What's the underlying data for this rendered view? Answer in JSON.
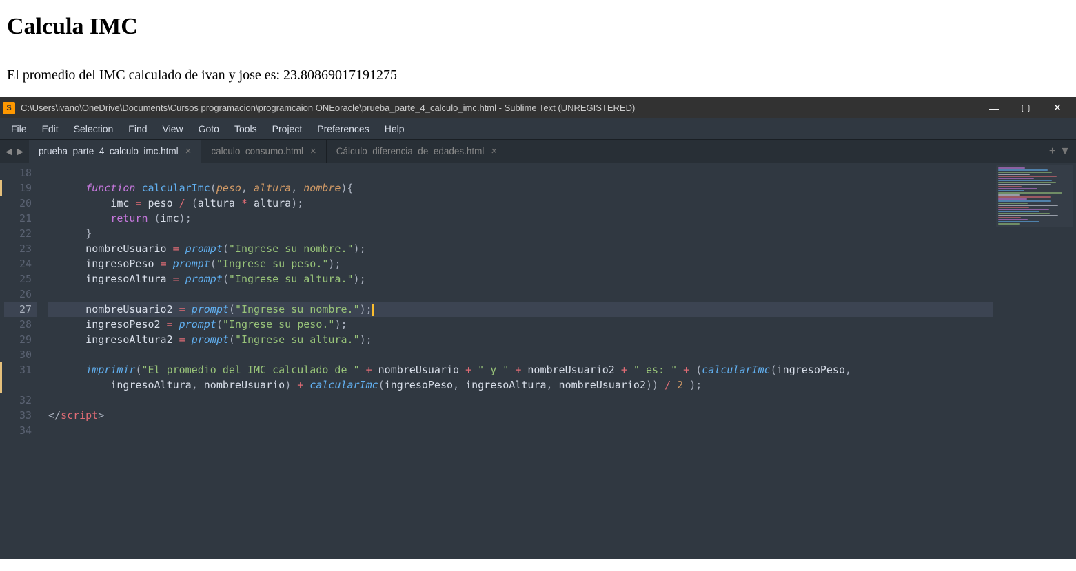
{
  "browser": {
    "heading": "Calcula IMC",
    "result_text": "El promedio del IMC calculado de ivan y jose es: 23.80869017191275"
  },
  "titlebar": {
    "icon_glyph": "S",
    "path": "C:\\Users\\ivano\\OneDrive\\Documents\\Cursos programacion\\programcaion ONEoracle\\prueba_parte_4_calculo_imc.html - Sublime Text (UNREGISTERED)"
  },
  "win": {
    "min": "—",
    "max": "▢",
    "close": "✕"
  },
  "menu": [
    "File",
    "Edit",
    "Selection",
    "Find",
    "View",
    "Goto",
    "Tools",
    "Project",
    "Preferences",
    "Help"
  ],
  "tabs": {
    "back": "◀",
    "fwd": "▶",
    "plus": "+",
    "drop": "▼",
    "items": [
      {
        "label": "prueba_parte_4_calculo_imc.html",
        "active": true
      },
      {
        "label": "calculo_consumo.html",
        "active": false
      },
      {
        "label": "Cálculo_diferencia_de_edades.html",
        "active": false
      }
    ]
  },
  "editor": {
    "first_line": 18,
    "current_line": 27,
    "marked_lines": [
      19,
      31
    ],
    "lines": [
      {
        "n": 18,
        "tokens": []
      },
      {
        "n": 19,
        "tokens": [
          {
            "t": "      ",
            "c": ""
          },
          {
            "t": "function",
            "c": "kw-it"
          },
          {
            "t": " ",
            "c": ""
          },
          {
            "t": "calcularImc",
            "c": "fn"
          },
          {
            "t": "(",
            "c": "pun"
          },
          {
            "t": "peso",
            "c": "param"
          },
          {
            "t": ",",
            "c": "pun"
          },
          {
            "t": " ",
            "c": ""
          },
          {
            "t": "altura",
            "c": "param"
          },
          {
            "t": ",",
            "c": "pun"
          },
          {
            "t": " ",
            "c": ""
          },
          {
            "t": "nombre",
            "c": "param"
          },
          {
            "t": ")",
            "c": "pun"
          },
          {
            "t": "{",
            "c": "pun"
          }
        ]
      },
      {
        "n": 20,
        "tokens": [
          {
            "t": "          imc ",
            "c": "var"
          },
          {
            "t": "=",
            "c": "op"
          },
          {
            "t": " peso ",
            "c": "var"
          },
          {
            "t": "/",
            "c": "op"
          },
          {
            "t": " ",
            "c": ""
          },
          {
            "t": "(",
            "c": "pun"
          },
          {
            "t": "altura ",
            "c": "var"
          },
          {
            "t": "*",
            "c": "op"
          },
          {
            "t": " altura",
            "c": "var"
          },
          {
            "t": ")",
            "c": "pun"
          },
          {
            "t": ";",
            "c": "pun"
          }
        ]
      },
      {
        "n": 21,
        "tokens": [
          {
            "t": "          ",
            "c": ""
          },
          {
            "t": "return",
            "c": "kw"
          },
          {
            "t": " ",
            "c": ""
          },
          {
            "t": "(",
            "c": "pun"
          },
          {
            "t": "imc",
            "c": "var"
          },
          {
            "t": ")",
            "c": "pun"
          },
          {
            "t": ";",
            "c": "pun"
          }
        ]
      },
      {
        "n": 22,
        "tokens": [
          {
            "t": "      ",
            "c": ""
          },
          {
            "t": "}",
            "c": "pun"
          }
        ]
      },
      {
        "n": 23,
        "tokens": [
          {
            "t": "      nombreUsuario ",
            "c": "var"
          },
          {
            "t": "=",
            "c": "op"
          },
          {
            "t": " ",
            "c": ""
          },
          {
            "t": "prompt",
            "c": "fn-it"
          },
          {
            "t": "(",
            "c": "pun"
          },
          {
            "t": "\"Ingrese su nombre.\"",
            "c": "str"
          },
          {
            "t": ")",
            "c": "pun"
          },
          {
            "t": ";",
            "c": "pun"
          }
        ]
      },
      {
        "n": 24,
        "tokens": [
          {
            "t": "      ingresoPeso ",
            "c": "var"
          },
          {
            "t": "=",
            "c": "op"
          },
          {
            "t": " ",
            "c": ""
          },
          {
            "t": "prompt",
            "c": "fn-it"
          },
          {
            "t": "(",
            "c": "pun"
          },
          {
            "t": "\"Ingrese su peso.\"",
            "c": "str"
          },
          {
            "t": ")",
            "c": "pun"
          },
          {
            "t": ";",
            "c": "pun"
          }
        ]
      },
      {
        "n": 25,
        "tokens": [
          {
            "t": "      ingresoAltura ",
            "c": "var"
          },
          {
            "t": "=",
            "c": "op"
          },
          {
            "t": " ",
            "c": ""
          },
          {
            "t": "prompt",
            "c": "fn-it"
          },
          {
            "t": "(",
            "c": "pun"
          },
          {
            "t": "\"Ingrese su altura.\"",
            "c": "str"
          },
          {
            "t": ")",
            "c": "pun"
          },
          {
            "t": ";",
            "c": "pun"
          }
        ]
      },
      {
        "n": 26,
        "tokens": []
      },
      {
        "n": 27,
        "tokens": [
          {
            "t": "      nombreUsuario2 ",
            "c": "var"
          },
          {
            "t": "=",
            "c": "op"
          },
          {
            "t": " ",
            "c": ""
          },
          {
            "t": "prompt",
            "c": "fn-it"
          },
          {
            "t": "(",
            "c": "pun"
          },
          {
            "t": "\"Ingrese su nombre.\"",
            "c": "str"
          },
          {
            "t": ")",
            "c": "pun"
          },
          {
            "t": ";",
            "c": "pun"
          }
        ]
      },
      {
        "n": 28,
        "tokens": [
          {
            "t": "      ingresoPeso2 ",
            "c": "var"
          },
          {
            "t": "=",
            "c": "op"
          },
          {
            "t": " ",
            "c": ""
          },
          {
            "t": "prompt",
            "c": "fn-it"
          },
          {
            "t": "(",
            "c": "pun"
          },
          {
            "t": "\"Ingrese su peso.\"",
            "c": "str"
          },
          {
            "t": ")",
            "c": "pun"
          },
          {
            "t": ";",
            "c": "pun"
          }
        ]
      },
      {
        "n": 29,
        "tokens": [
          {
            "t": "      ingresoAltura2 ",
            "c": "var"
          },
          {
            "t": "=",
            "c": "op"
          },
          {
            "t": " ",
            "c": ""
          },
          {
            "t": "prompt",
            "c": "fn-it"
          },
          {
            "t": "(",
            "c": "pun"
          },
          {
            "t": "\"Ingrese su altura.\"",
            "c": "str"
          },
          {
            "t": ")",
            "c": "pun"
          },
          {
            "t": ";",
            "c": "pun"
          }
        ]
      },
      {
        "n": 30,
        "tokens": []
      },
      {
        "n": 31,
        "tokens": [
          {
            "t": "      ",
            "c": ""
          },
          {
            "t": "imprimir",
            "c": "fn-it"
          },
          {
            "t": "(",
            "c": "pun"
          },
          {
            "t": "\"El promedio del IMC calculado de \"",
            "c": "str"
          },
          {
            "t": " ",
            "c": ""
          },
          {
            "t": "+",
            "c": "op"
          },
          {
            "t": " nombreUsuario ",
            "c": "var"
          },
          {
            "t": "+",
            "c": "op"
          },
          {
            "t": " ",
            "c": ""
          },
          {
            "t": "\" y \"",
            "c": "str"
          },
          {
            "t": " ",
            "c": ""
          },
          {
            "t": "+",
            "c": "op"
          },
          {
            "t": " nombreUsuario2 ",
            "c": "var"
          },
          {
            "t": "+",
            "c": "op"
          },
          {
            "t": " ",
            "c": ""
          },
          {
            "t": "\" es: \"",
            "c": "str"
          },
          {
            "t": " ",
            "c": ""
          },
          {
            "t": "+",
            "c": "op"
          },
          {
            "t": " ",
            "c": ""
          },
          {
            "t": "(",
            "c": "pun"
          },
          {
            "t": "calcularImc",
            "c": "fn-it"
          },
          {
            "t": "(",
            "c": "pun"
          },
          {
            "t": "ingresoPeso",
            "c": "var"
          },
          {
            "t": ",",
            "c": "pun"
          },
          {
            "t": " ",
            "c": ""
          },
          {
            "t": "\n          ingresoAltura",
            "c": "var"
          },
          {
            "t": ",",
            "c": "pun"
          },
          {
            "t": " nombreUsuario",
            "c": "var"
          },
          {
            "t": ")",
            "c": "pun"
          },
          {
            "t": " ",
            "c": ""
          },
          {
            "t": "+",
            "c": "op"
          },
          {
            "t": " ",
            "c": ""
          },
          {
            "t": "calcularImc",
            "c": "fn-it"
          },
          {
            "t": "(",
            "c": "pun"
          },
          {
            "t": "ingresoPeso",
            "c": "var"
          },
          {
            "t": ",",
            "c": "pun"
          },
          {
            "t": " ingresoAltura",
            "c": "var"
          },
          {
            "t": ",",
            "c": "pun"
          },
          {
            "t": " nombreUsuario2",
            "c": "var"
          },
          {
            "t": ")",
            "c": "pun"
          },
          {
            "t": ")",
            "c": "pun"
          },
          {
            "t": " ",
            "c": ""
          },
          {
            "t": "/",
            "c": "op"
          },
          {
            "t": " ",
            "c": ""
          },
          {
            "t": "2",
            "c": "num"
          },
          {
            "t": " ",
            "c": ""
          },
          {
            "t": ")",
            "c": "pun"
          },
          {
            "t": ";",
            "c": "pun"
          }
        ]
      },
      {
        "n": 32,
        "tokens": []
      },
      {
        "n": 33,
        "tokens": [
          {
            "t": "</",
            "c": "pun"
          },
          {
            "t": "script",
            "c": "tag"
          },
          {
            "t": ">",
            "c": "pun"
          }
        ]
      },
      {
        "n": 34,
        "tokens": []
      }
    ]
  }
}
